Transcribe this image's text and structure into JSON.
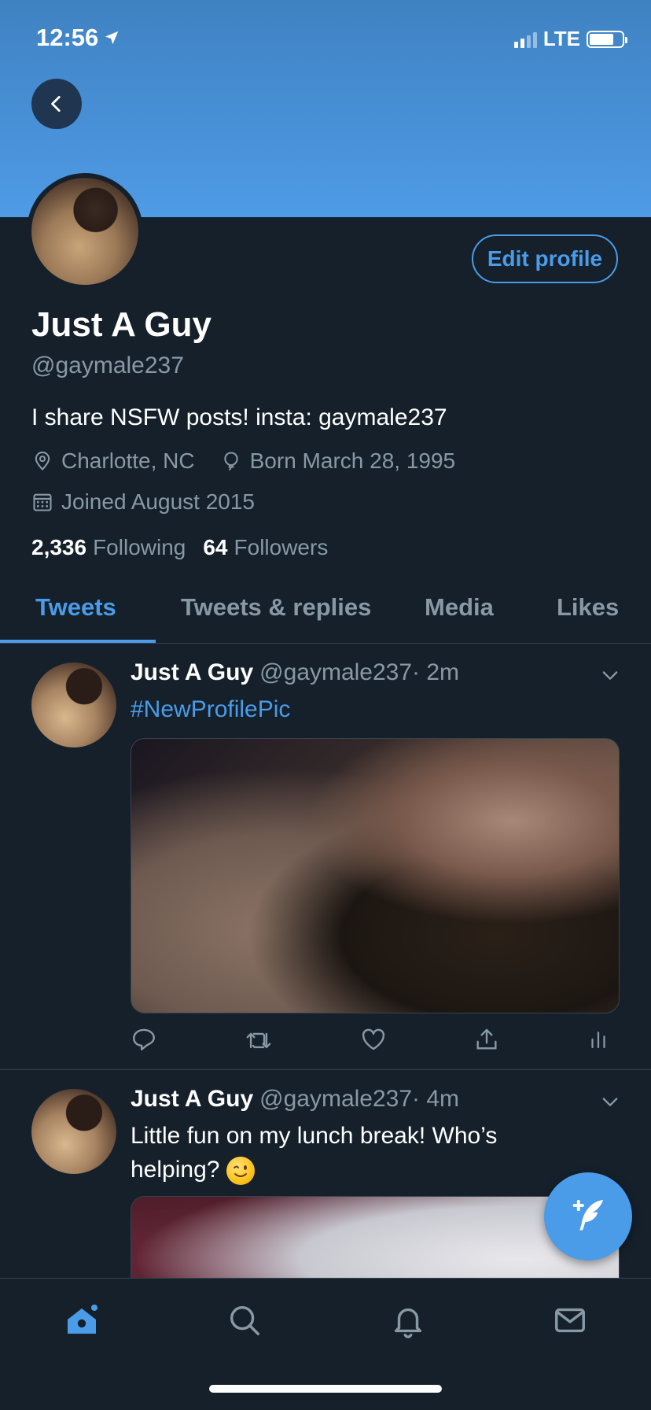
{
  "status_bar": {
    "time": "12:56",
    "network": "LTE",
    "battery_percent": 75
  },
  "profile": {
    "name": "Just A Guy",
    "handle": "@gaymale237",
    "bio": "I share NSFW posts! insta: gaymale237",
    "location": "Charlotte, NC",
    "birthday": "Born March 28, 1995",
    "joined": "Joined August 2015",
    "following_count": "2,336",
    "following_label": "Following",
    "followers_count": "64",
    "followers_label": "Followers",
    "edit_button": "Edit profile"
  },
  "tabs": [
    {
      "label": "Tweets",
      "active": true
    },
    {
      "label": "Tweets & replies",
      "active": false
    },
    {
      "label": "Media",
      "active": false
    },
    {
      "label": "Likes",
      "active": false
    }
  ],
  "tweets": [
    {
      "name": "Just A Guy",
      "handle": "@gaymale237",
      "time": "· 2m",
      "text": "#NewProfilePic"
    },
    {
      "name": "Just A Guy",
      "handle": "@gaymale237",
      "time": "· 4m",
      "text_line1": "Little fun on my lunch break! Who’s",
      "text_line2": "helping?"
    }
  ],
  "icons": {
    "back": "chevron-left-icon",
    "location": "location-pin-icon",
    "birthday": "balloon-icon",
    "joined": "calendar-icon",
    "reply": "reply-icon",
    "retweet": "retweet-icon",
    "like": "heart-icon",
    "share": "share-icon",
    "analytics": "analytics-icon",
    "compose": "compose-tweet-icon",
    "home": "home-icon",
    "search": "search-icon",
    "notifications": "bell-icon",
    "messages": "mail-icon"
  },
  "colors": {
    "accent": "#4a9ce8",
    "background": "#15202b",
    "secondary_text": "#8899a6",
    "border": "#38444d"
  }
}
